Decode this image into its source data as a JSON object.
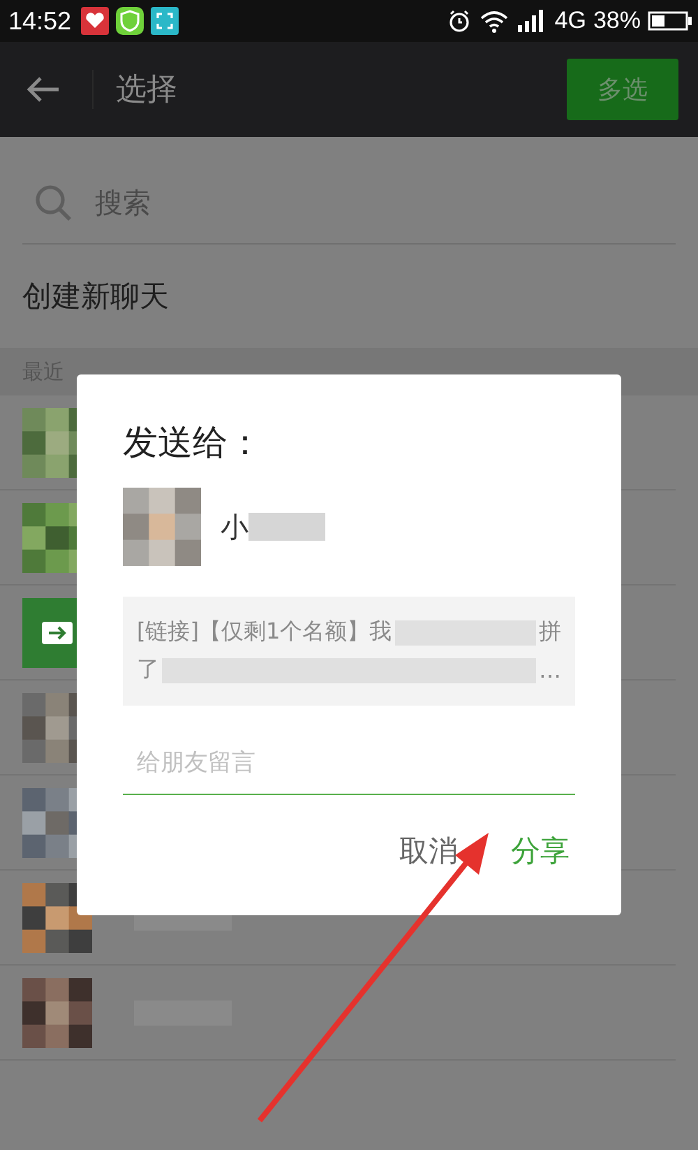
{
  "status_bar": {
    "time": "14:52",
    "network": "4G",
    "battery": "38%"
  },
  "header": {
    "title": "选择",
    "action": "多选"
  },
  "search": {
    "placeholder": "搜索"
  },
  "new_chat": "创建新聊天",
  "section_title": "最近",
  "contacts": [
    {
      "kind": "picture"
    },
    {
      "kind": "picture"
    },
    {
      "kind": "icon"
    },
    {
      "kind": "picture"
    },
    {
      "kind": "picture"
    },
    {
      "kind": "picture",
      "name": {
        "kind": "blur"
      }
    },
    {
      "kind": "picture",
      "name": {
        "kind": "blur"
      }
    }
  ],
  "dialog": {
    "title": "发送给：",
    "recipient": {
      "name": "小"
    },
    "preview": [
      [
        {
          "kind": "text",
          "text": "[链接]【仅剩1个名额】我"
        },
        {
          "kind": "blur"
        },
        {
          "kind": "text",
          "text": "拼"
        }
      ],
      [
        {
          "kind": "text",
          "text": "了"
        },
        {
          "kind": "blur"
        },
        {
          "kind": "text",
          "text": "…"
        }
      ]
    ],
    "message": {
      "placeholder": "给朋友留言"
    },
    "buttons": [
      {
        "label": "取消",
        "kind": "cancel"
      },
      {
        "label": "分享",
        "kind": "primary"
      }
    ]
  }
}
